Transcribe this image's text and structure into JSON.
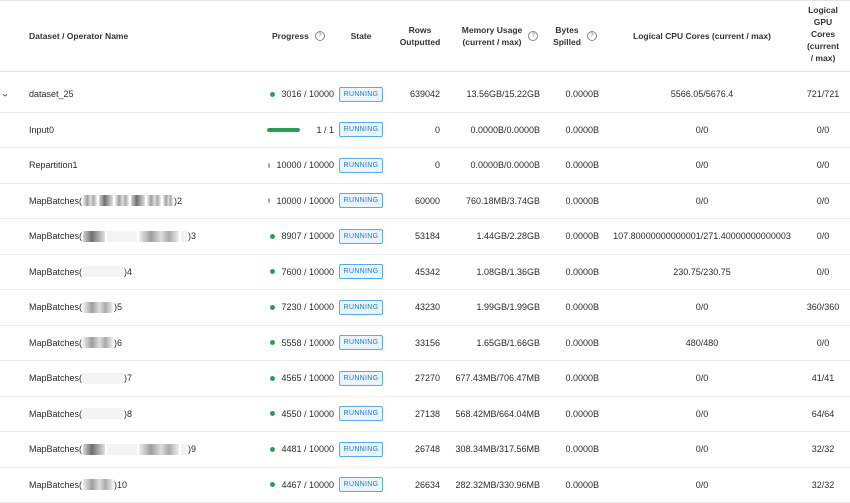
{
  "header": {
    "name": "Dataset / Operator Name",
    "progress": "Progress",
    "state": "State",
    "rows_outputted": [
      "Rows",
      "Outputted"
    ],
    "memory_usage": [
      "Memory Usage",
      "(current / max)"
    ],
    "bytes_spilled": [
      "Bytes",
      "Spilled"
    ],
    "cpu": "Logical CPU Cores (current / max)",
    "gpu": [
      "Logical",
      "GPU",
      "Cores",
      "(current",
      "/ max)"
    ]
  },
  "rows": [
    {
      "name_prefix": "dataset_25",
      "name_suffix": "",
      "progress": "3016 / 10000",
      "progress_fraction": 0.3016,
      "indicator": "dot",
      "state": "RUNNING",
      "rows": "639042",
      "memory": "13.56GB/15.22GB",
      "bytes": "0.0000B",
      "cpu": "5566.05/5676.4",
      "gpu": "721/721",
      "expandable": true
    },
    {
      "name_prefix": "Input0",
      "name_suffix": "",
      "progress": "1 / 1",
      "progress_fraction": 1.0,
      "indicator": "bar",
      "state": "RUNNING",
      "rows": "0",
      "memory": "0.0000B/0.0000B",
      "bytes": "0.0000B",
      "cpu": "0/0",
      "gpu": "0/0"
    },
    {
      "name_prefix": "Repartition1",
      "name_suffix": "",
      "progress": "10000 / 10000",
      "progress_fraction": 1.0,
      "indicator": "none",
      "state": "RUNNING",
      "rows": "0",
      "memory": "0.0000B/0.0000B",
      "bytes": "0.0000B",
      "cpu": "0/0",
      "gpu": "0/0"
    },
    {
      "name_prefix": "MapBatches(",
      "name_suffix": ")2",
      "redact": "mixed",
      "progress": "10000 / 10000",
      "progress_fraction": 1.0,
      "indicator": "none",
      "state": "RUNNING",
      "rows": "60000",
      "memory": "760.18MB/3.74GB",
      "bytes": "0.0000B",
      "cpu": "0/0",
      "gpu": "0/0"
    },
    {
      "name_prefix": "MapBatches(",
      "name_suffix": ")3",
      "redact": "split",
      "progress": "8907 / 10000",
      "progress_fraction": 0.8907,
      "indicator": "dot",
      "state": "RUNNING",
      "rows": "53184",
      "memory": "1.44GB/2.28GB",
      "bytes": "0.0000B",
      "cpu": "107.80000000000001/271.40000000000003",
      "gpu": "0/0"
    },
    {
      "name_prefix": "MapBatches(",
      "name_suffix": ")4",
      "redact": "light",
      "progress": "7600 / 10000",
      "progress_fraction": 0.76,
      "indicator": "dot",
      "state": "RUNNING",
      "rows": "45342",
      "memory": "1.08GB/1.36GB",
      "bytes": "0.0000B",
      "cpu": "230.75/230.75",
      "gpu": "0/0"
    },
    {
      "name_prefix": "MapBatches(",
      "name_suffix": ")5",
      "redact": "short",
      "progress": "7230 / 10000",
      "progress_fraction": 0.723,
      "indicator": "dot",
      "state": "RUNNING",
      "rows": "43230",
      "memory": "1.99GB/1.99GB",
      "bytes": "0.0000B",
      "cpu": "0/0",
      "gpu": "360/360"
    },
    {
      "name_prefix": "MapBatches(",
      "name_suffix": ")6",
      "redact": "short",
      "progress": "5558 / 10000",
      "progress_fraction": 0.5558,
      "indicator": "dot",
      "state": "RUNNING",
      "rows": "33156",
      "memory": "1.65GB/1.66GB",
      "bytes": "0.0000B",
      "cpu": "480/480",
      "gpu": "0/0"
    },
    {
      "name_prefix": "MapBatches(",
      "name_suffix": ")7",
      "redact": "light",
      "progress": "4565 / 10000",
      "progress_fraction": 0.4565,
      "indicator": "dot",
      "state": "RUNNING",
      "rows": "27270",
      "memory": "677.43MB/706.47MB",
      "bytes": "0.0000B",
      "cpu": "0/0",
      "gpu": "41/41"
    },
    {
      "name_prefix": "MapBatches(",
      "name_suffix": ")8",
      "redact": "light",
      "progress": "4550 / 10000",
      "progress_fraction": 0.455,
      "indicator": "dot",
      "state": "RUNNING",
      "rows": "27138",
      "memory": "568.42MB/664.04MB",
      "bytes": "0.0000B",
      "cpu": "0/0",
      "gpu": "64/64"
    },
    {
      "name_prefix": "MapBatches(",
      "name_suffix": ")9",
      "redact": "split",
      "progress": "4481 / 10000",
      "progress_fraction": 0.4481,
      "indicator": "dot",
      "state": "RUNNING",
      "rows": "26748",
      "memory": "308.34MB/317.56MB",
      "bytes": "0.0000B",
      "cpu": "0/0",
      "gpu": "32/32"
    },
    {
      "name_prefix": "MapBatches(",
      "name_suffix": ")10",
      "redact": "short",
      "progress": "4467 / 10000",
      "progress_fraction": 0.4467,
      "indicator": "dot",
      "state": "RUNNING",
      "rows": "26634",
      "memory": "282.32MB/330.96MB",
      "bytes": "0.0000B",
      "cpu": "0/0",
      "gpu": "32/32"
    }
  ],
  "colors": {
    "badge_text": "#1e7ac8",
    "badge_border": "#58a9e6",
    "badge_bg": "#e9f4fd",
    "progress": "#2e9b55",
    "track": "#e0e0e0"
  },
  "icons": {
    "help": "help-circle-icon",
    "expand": "chevron-down-icon"
  }
}
